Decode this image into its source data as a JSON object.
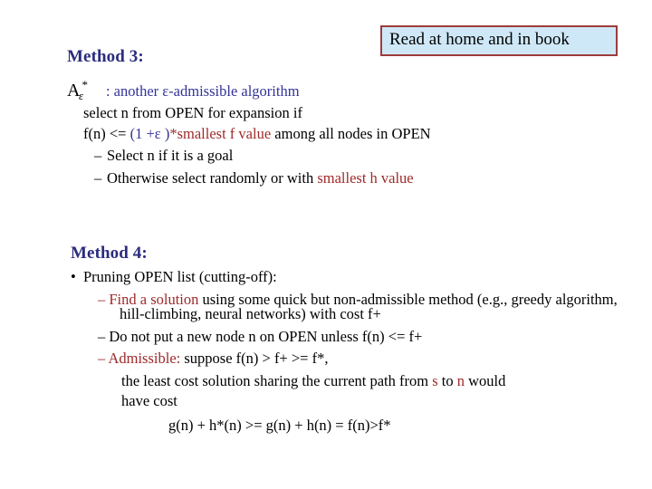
{
  "slide": {
    "callout": {
      "text": "Read at home and in book",
      "fill_color": "#cfe8f7",
      "border_color": "#9e3b3b"
    },
    "method3": {
      "heading": "Method 3:",
      "heading_color": "#2b2b7f",
      "formula_symbol": {
        "base": "A",
        "superscript": "*",
        "subscript": "ε"
      },
      "line1_rest": ": another  ε-admissible algorithm",
      "line1_rest_color": "#333399",
      "line2": "select n from OPEN for expansion if",
      "line3": {
        "part_black_1": "f(n) <= ",
        "part_blue": "(1 +ε  )",
        "part_red_star": "*",
        "part_red": "smallest f value",
        "part_black_2": " among all nodes in OPEN"
      },
      "sub_bullets": [
        {
          "dash": "–",
          "text": "Select n if it is a goal"
        },
        {
          "dash": "–",
          "text_black_1": "Otherwise select randomly or with ",
          "text_red": "smallest h value"
        }
      ]
    },
    "method4": {
      "heading": "Method 4:",
      "heading_color": "#2b2b7f",
      "bullet_glyph": "•",
      "bullet_text": "Pruning OPEN list (cutting-off):",
      "items": [
        {
          "dash": "–",
          "lead_red": "Find a solution",
          "rest_black": " using some quick but non-admissible method (e.g., greedy algorithm, hill-climbing, neural networks) with cost f+",
          "dash_color": "#9e2a2a"
        },
        {
          "dash": "–",
          "rest_black": "Do not put a new node n on OPEN unless f(n) <= f+",
          "dash_color": "#000000"
        },
        {
          "dash": "–",
          "lead_red": "Admissible:",
          "rest_black": " suppose f(n) > f+ >= f*,",
          "dash_color": "#9e2a2a"
        }
      ],
      "continuation": {
        "part_1": "the least cost solution sharing the current path from ",
        "red_s": "s",
        "part_2": " to ",
        "red_n": "n",
        "part_3": " would"
      },
      "continuation_line2": "have cost",
      "formula": "g(n) + h*(n) >= g(n) + h(n) = f(n)>f*"
    },
    "colors": {
      "heading_blue": "#2b2b7f",
      "body_blue": "#333399",
      "accent_red": "#9e2a2a",
      "text_black": "#000000"
    }
  }
}
